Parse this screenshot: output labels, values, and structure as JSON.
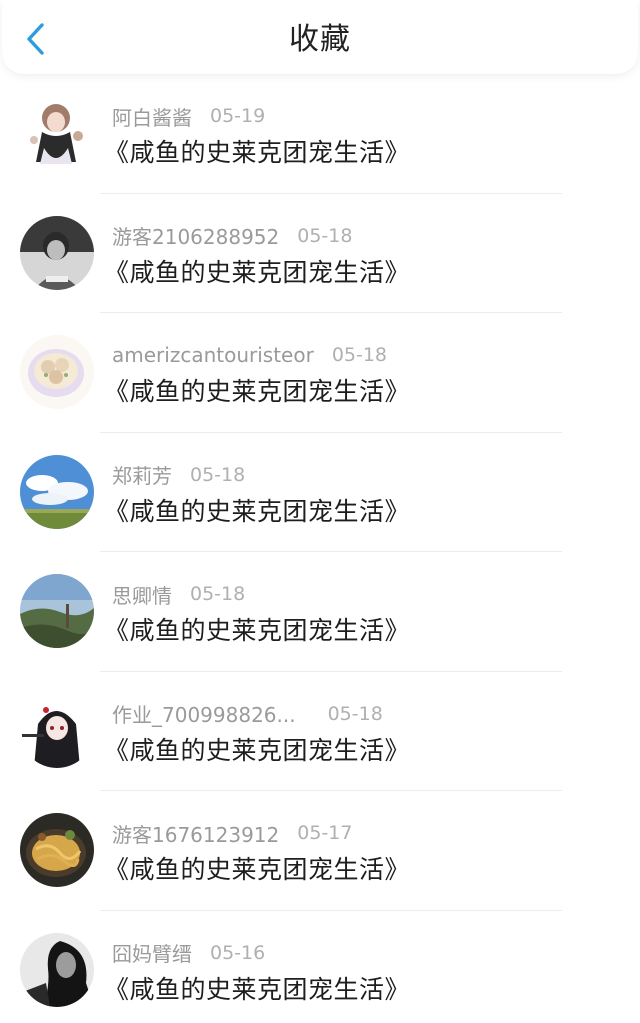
{
  "header": {
    "title": "收藏",
    "back_icon": "chevron-left-icon",
    "accent_color": "#2e9bdf"
  },
  "items": [
    {
      "user": "阿白酱酱",
      "date": "05-19",
      "book": "《咸鱼的史莱克团宠生活》",
      "avatar": "anime-girl-avatar"
    },
    {
      "user": "游客2106288952",
      "date": "05-18",
      "book": "《咸鱼的史莱克团宠生活》",
      "avatar": "monochrome-person-avatar"
    },
    {
      "user": "amerizcantouristeor",
      "date": "05-18",
      "book": "《咸鱼的史莱克团宠生活》",
      "avatar": "food-bowl-avatar"
    },
    {
      "user": "郑莉芳",
      "date": "05-18",
      "book": "《咸鱼的史莱克团宠生活》",
      "avatar": "sky-clouds-avatar"
    },
    {
      "user": "思卿情",
      "date": "05-18",
      "book": "《咸鱼的史莱克团宠生活》",
      "avatar": "landscape-avatar"
    },
    {
      "user": "作业_700998826...",
      "date": "05-18",
      "book": "《咸鱼的史莱克团宠生活》",
      "avatar": "anime-dark-girl-avatar"
    },
    {
      "user": "游客1676123912",
      "date": "05-17",
      "book": "《咸鱼的史莱克团宠生活》",
      "avatar": "noodles-avatar"
    },
    {
      "user": "囧妈臂缙",
      "date": "05-16",
      "book": "《咸鱼的史莱克团宠生活》",
      "avatar": "bw-man-avatar"
    }
  ]
}
